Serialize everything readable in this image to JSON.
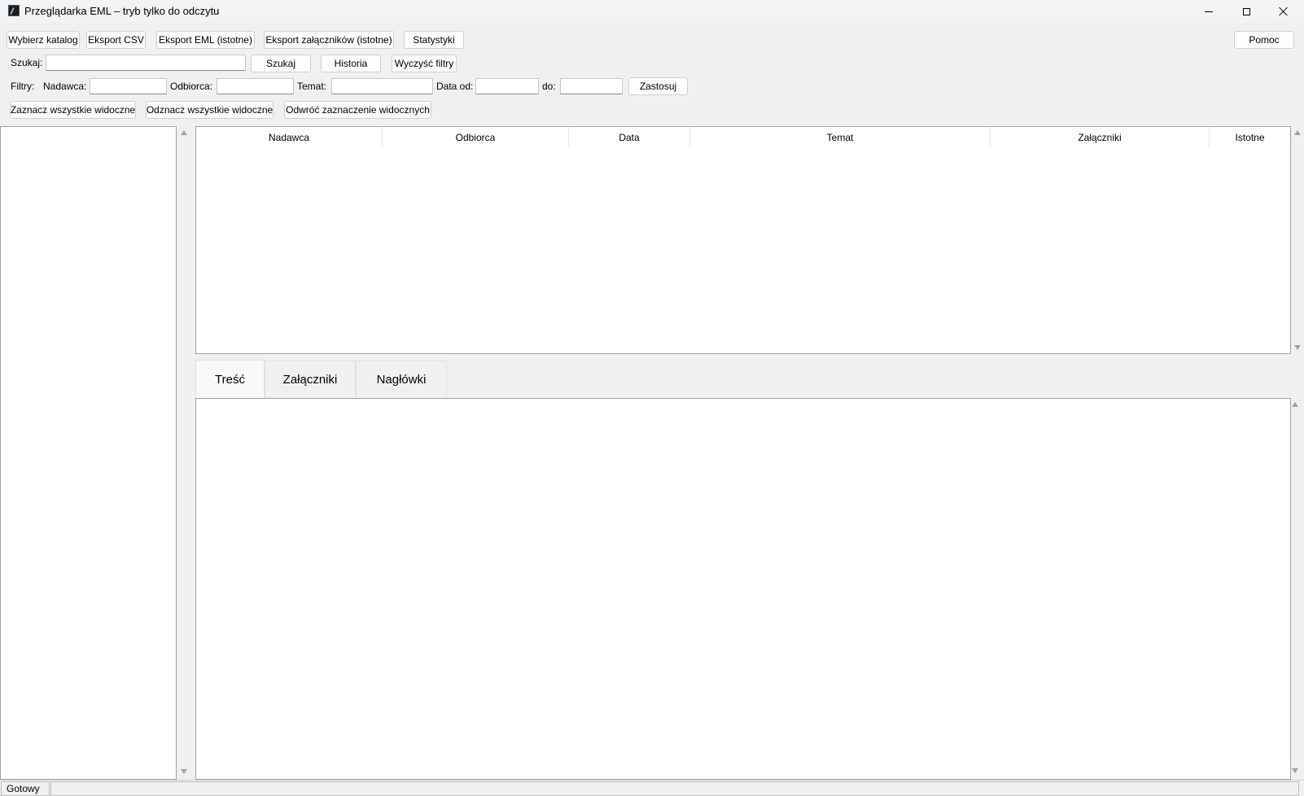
{
  "window": {
    "title": "Przeglądarka EML – tryb tylko do odczytu"
  },
  "toolbar": {
    "choose_dir": "Wybierz katalog",
    "export_csv": "Eksport CSV",
    "export_eml": "Eksport EML (istotne)",
    "export_attachments": "Eksport załączników (istotne)",
    "stats": "Statystyki",
    "help": "Pomoc"
  },
  "search": {
    "label": "Szukaj:",
    "value": "",
    "search_button": "Szukaj",
    "history_button": "Historia",
    "clear_button": "Wyczyść filtry"
  },
  "filters": {
    "label": "Filtry:",
    "sender_label": "Nadawca:",
    "sender_value": "",
    "recipient_label": "Odbiorca:",
    "recipient_value": "",
    "subject_label": "Temat:",
    "subject_value": "",
    "date_from_label": "Data od:",
    "date_from_value": "",
    "date_to_label": "do:",
    "date_to_value": "",
    "apply_button": "Zastosuj"
  },
  "selection": {
    "select_all": "Zaznacz wszystkie widoczne",
    "deselect_all": "Odznacz wszystkie widoczne",
    "invert": "Odwróć zaznaczenie widocznych"
  },
  "table": {
    "columns": [
      "Nadawca",
      "Odbiorca",
      "Data",
      "Temat",
      "Załączniki",
      "Istotne"
    ],
    "rows": []
  },
  "tabs": [
    {
      "label": "Treść",
      "active": true
    },
    {
      "label": "Załączniki",
      "active": false
    },
    {
      "label": "Nagłówki",
      "active": false
    }
  ],
  "status": {
    "text": "Gotowy"
  }
}
